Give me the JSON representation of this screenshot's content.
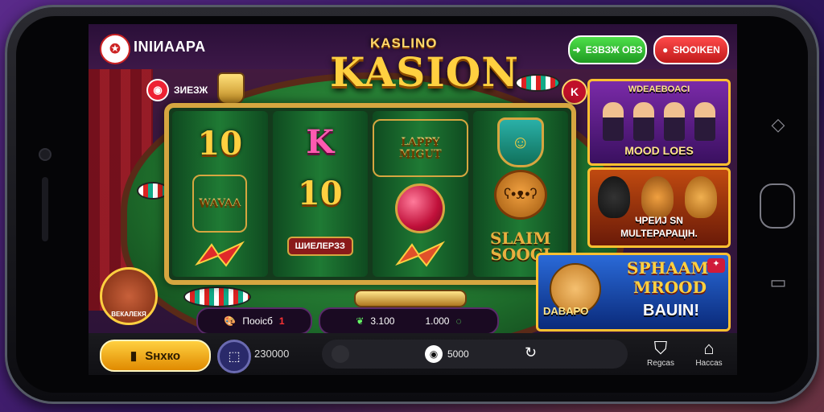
{
  "header": {
    "logo_text": "INIИAAPA",
    "title_small": "KASLINO",
    "title_big": "KASION",
    "btn_green_label": "ЕЗВЗЖ ОВЗ",
    "btn_red_label": "SЮОIKEN"
  },
  "board": {
    "badge_label": "ЗИЕЗЖ",
    "k_badge": "K",
    "reels": [
      [
        "10",
        "WAVA",
        "slash"
      ],
      [
        "K",
        "10",
        "banner"
      ],
      [
        "HAPPY",
        "ball",
        "slash"
      ],
      [
        "shield",
        "lion",
        "SLAIM"
      ]
    ],
    "banner_text": "ШИЕЛЕРЗЗ",
    "happy_text": "LAPPY MIGUT",
    "wava_text": "WAVAA",
    "slam_line1": "SLAIM",
    "slam_line2": "SOOCI"
  },
  "stats": {
    "left_label": "Пооiсб",
    "left_badge": "1",
    "mid_value": "3.100",
    "right_value": "1.000"
  },
  "promos": {
    "p1_title_top": "WDEAEBOACI",
    "p1_title_bottom": "MOOD LOES",
    "p2_title_line1": "ЧРЕИЈ SN",
    "p2_title_line2": "MULTЕРАРАЦІН.",
    "p3_title_line1": "SPHAAM",
    "p3_title_line2": "MROOD",
    "p3_title_line3": "BAUIN!",
    "p3_left_label": "DABAPO"
  },
  "avatar_label": "ВЕКАЛЕКЯ",
  "bottom": {
    "spin_label": "Sнхко",
    "balance": "230000",
    "mid_value": "5000",
    "nav1_label": "Regcas",
    "nav2_label": "Haccas"
  },
  "icons": {
    "spin": "coin-stack-icon",
    "balance": "wallet-icon",
    "nav1": "shield-icon",
    "nav2": "home-icon"
  }
}
